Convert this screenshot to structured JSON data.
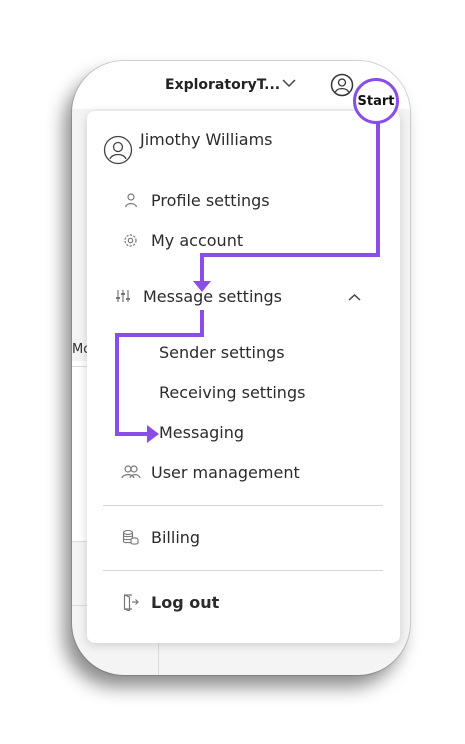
{
  "header": {
    "org_name": "ExploratoryT...",
    "org_chevron_icon": "chevron-down-icon",
    "avatar_icon": "user-avatar-icon"
  },
  "background": {
    "partial_text": "Mo"
  },
  "menu": {
    "user_name": "Jimothy Williams",
    "items": {
      "profile_settings": "Profile settings",
      "my_account": "My account",
      "message_settings": "Message settings",
      "sender_settings": "Sender settings",
      "receiving_settings": "Receiving settings",
      "messaging": "Messaging",
      "user_management": "User management",
      "billing": "Billing",
      "log_out": "Log out"
    },
    "icons": {
      "profile": "person-icon",
      "account": "gear-icon",
      "message_settings": "sliders-icon",
      "expand": "chevron-up-icon",
      "users": "users-icon",
      "billing": "coins-icon",
      "logout": "logout-icon"
    }
  },
  "annotation": {
    "start_label": "Start",
    "accent_color": "#8a4de8"
  }
}
